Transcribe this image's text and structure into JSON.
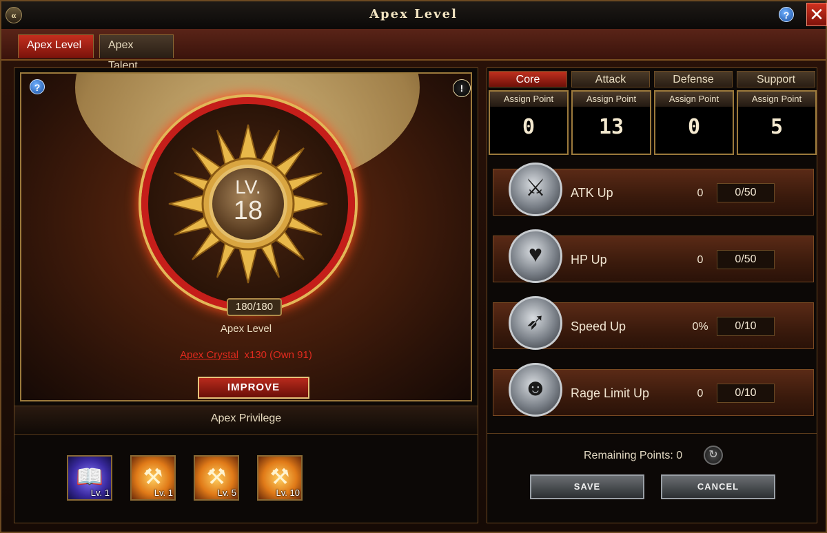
{
  "window": {
    "title": "Apex Level"
  },
  "tabs": [
    {
      "label": "Apex Level",
      "active": true
    },
    {
      "label": "Apex Talent",
      "active": false
    }
  ],
  "apex": {
    "lv_label": "LV.",
    "level": "18",
    "progress": "180/180",
    "caption": "Apex Level",
    "crystal_name": "Apex Crystal",
    "crystal_cost": "x130 (Own 91)",
    "improve_label": "IMPROVE"
  },
  "privilege": {
    "title": "Apex Privilege",
    "items": [
      {
        "icon": "book-icon",
        "level": "Lv. 1"
      },
      {
        "icon": "hammer-icon",
        "level": "Lv. 1"
      },
      {
        "icon": "hammer-icon",
        "level": "Lv. 5"
      },
      {
        "icon": "hammer-icon",
        "level": "Lv. 10"
      }
    ]
  },
  "categories": [
    {
      "label": "Core",
      "active": true,
      "assign_label": "Assign Point",
      "points": "0"
    },
    {
      "label": "Attack",
      "active": false,
      "assign_label": "Assign Point",
      "points": "13"
    },
    {
      "label": "Defense",
      "active": false,
      "assign_label": "Assign Point",
      "points": "0"
    },
    {
      "label": "Support",
      "active": false,
      "assign_label": "Assign Point",
      "points": "5"
    }
  ],
  "skills": [
    {
      "name": "ATK Up",
      "value": "0",
      "cap": "0/50",
      "icon": "sword-icon"
    },
    {
      "name": "HP Up",
      "value": "0",
      "cap": "0/50",
      "icon": "heart-icon"
    },
    {
      "name": "Speed Up",
      "value": "0%",
      "cap": "0/10",
      "icon": "boot-icon"
    },
    {
      "name": "Rage Limit Up",
      "value": "0",
      "cap": "0/10",
      "icon": "rage-icon"
    }
  ],
  "footer": {
    "remaining": "Remaining Points: 0",
    "save_label": "SAVE",
    "cancel_label": "CANCEL"
  },
  "colors": {
    "accent_red": "#c51e1a",
    "gold": "#e2b758",
    "crystal_text": "#e02a1e"
  }
}
